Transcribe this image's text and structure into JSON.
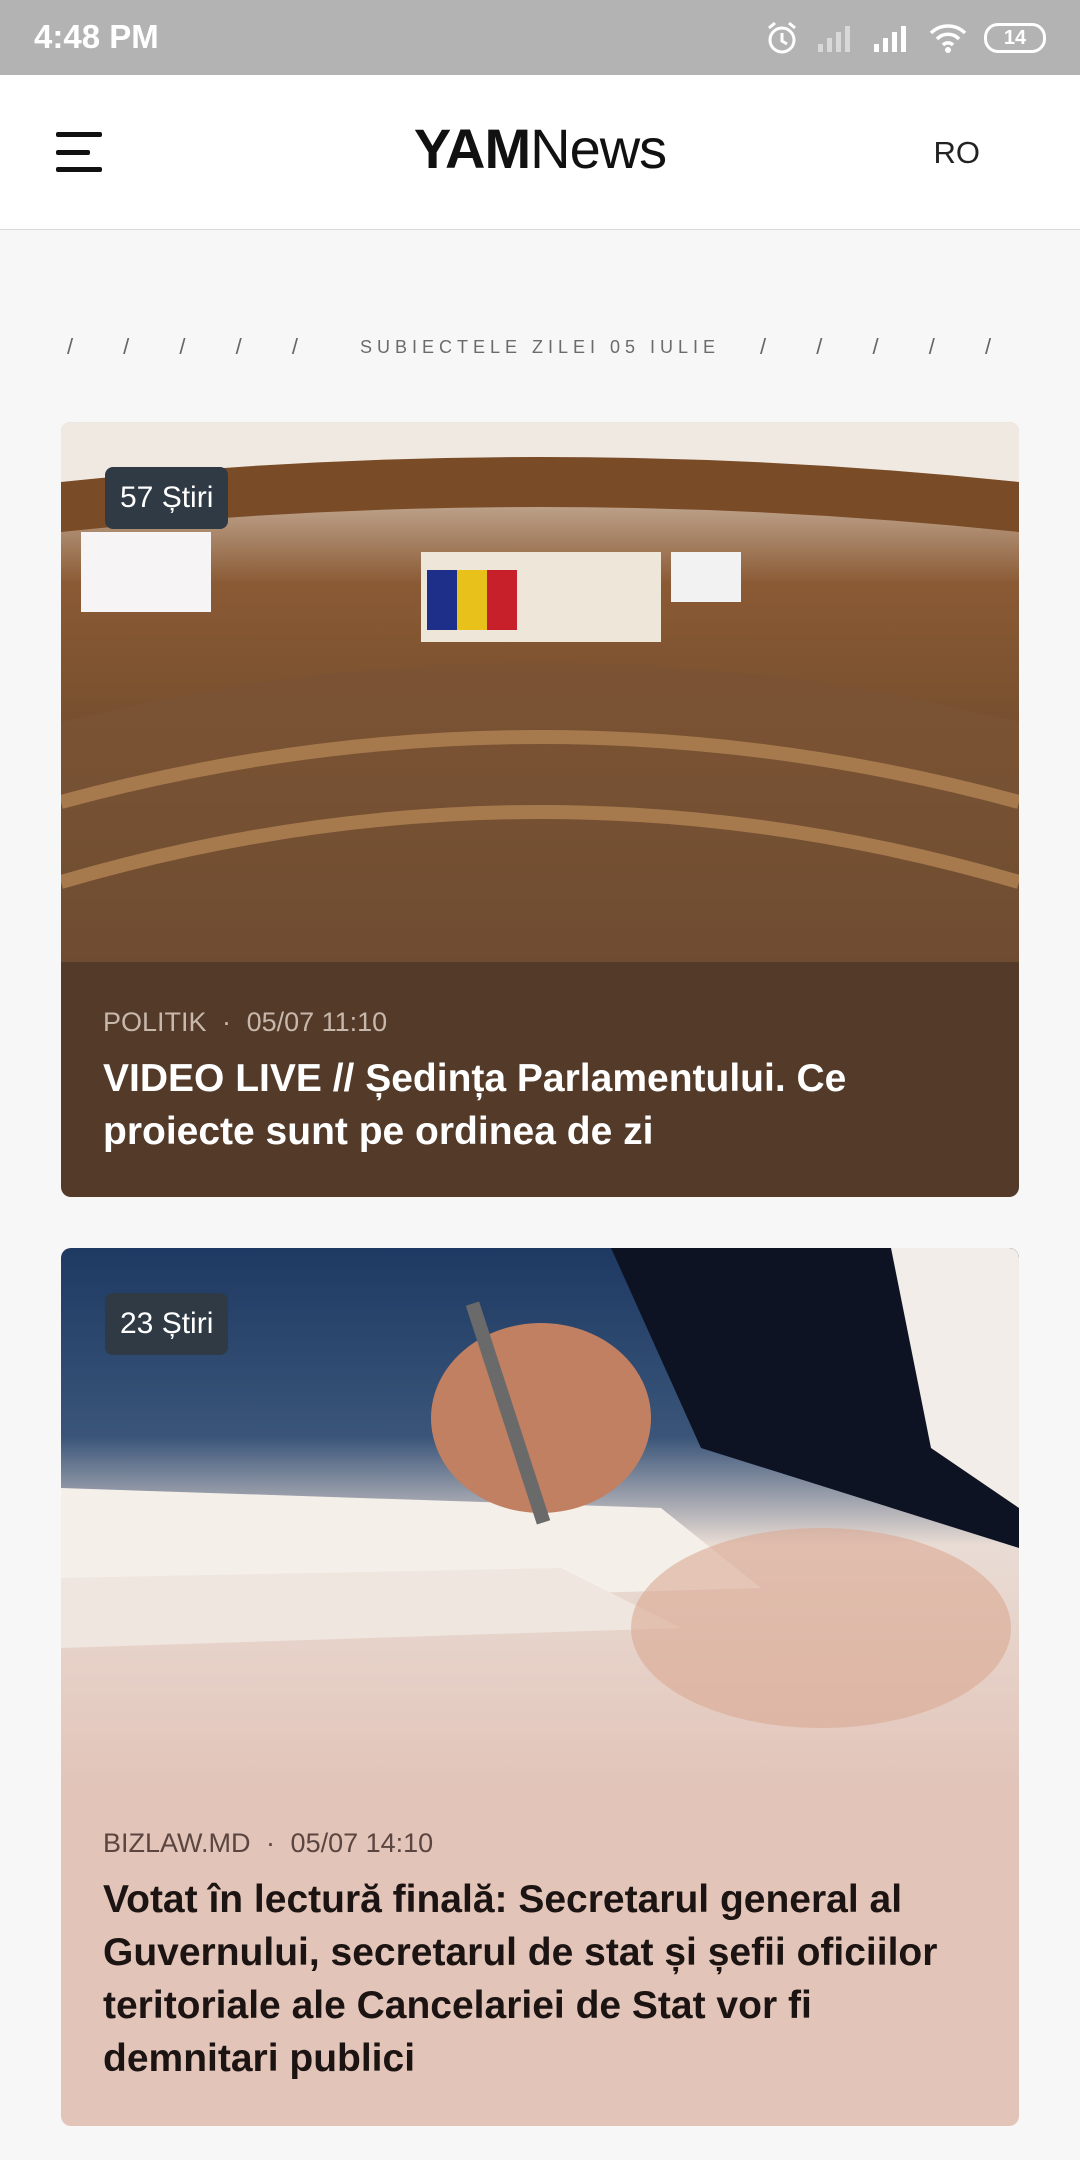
{
  "status_bar": {
    "time": "4:48 PM",
    "battery": "14",
    "icons": [
      "alarm-icon",
      "signal-off-icon",
      "signal-icon",
      "wifi-icon",
      "battery-icon"
    ]
  },
  "app_bar": {
    "logo_bold": "YAM",
    "logo_light": "News",
    "language": "RO"
  },
  "topics_header": {
    "left_slashes": "/ / / / /",
    "label": "SUBIECTELE ZILEI 05 IULIE",
    "right_slashes": "/ / / / /"
  },
  "articles": [
    {
      "badge": "57 Știri",
      "source": "POLITIK",
      "separator": "·",
      "time": "05/07 11:10",
      "title": "VIDEO LIVE // Ședința Parlamentului. Ce proiecte sunt pe ordinea de zi",
      "color": "#533a29"
    },
    {
      "badge": "23 Știri",
      "source": "BIZLAW.MD",
      "separator": "·",
      "time": "05/07 14:10",
      "title": "Votat în lectură finală: Secretarul general al Guvernului, secretarul de stat și șefii oficiilor teritoriale ale Cancelariei de Stat vor fi demnitari publici",
      "color": "#e2c4b9"
    }
  ]
}
